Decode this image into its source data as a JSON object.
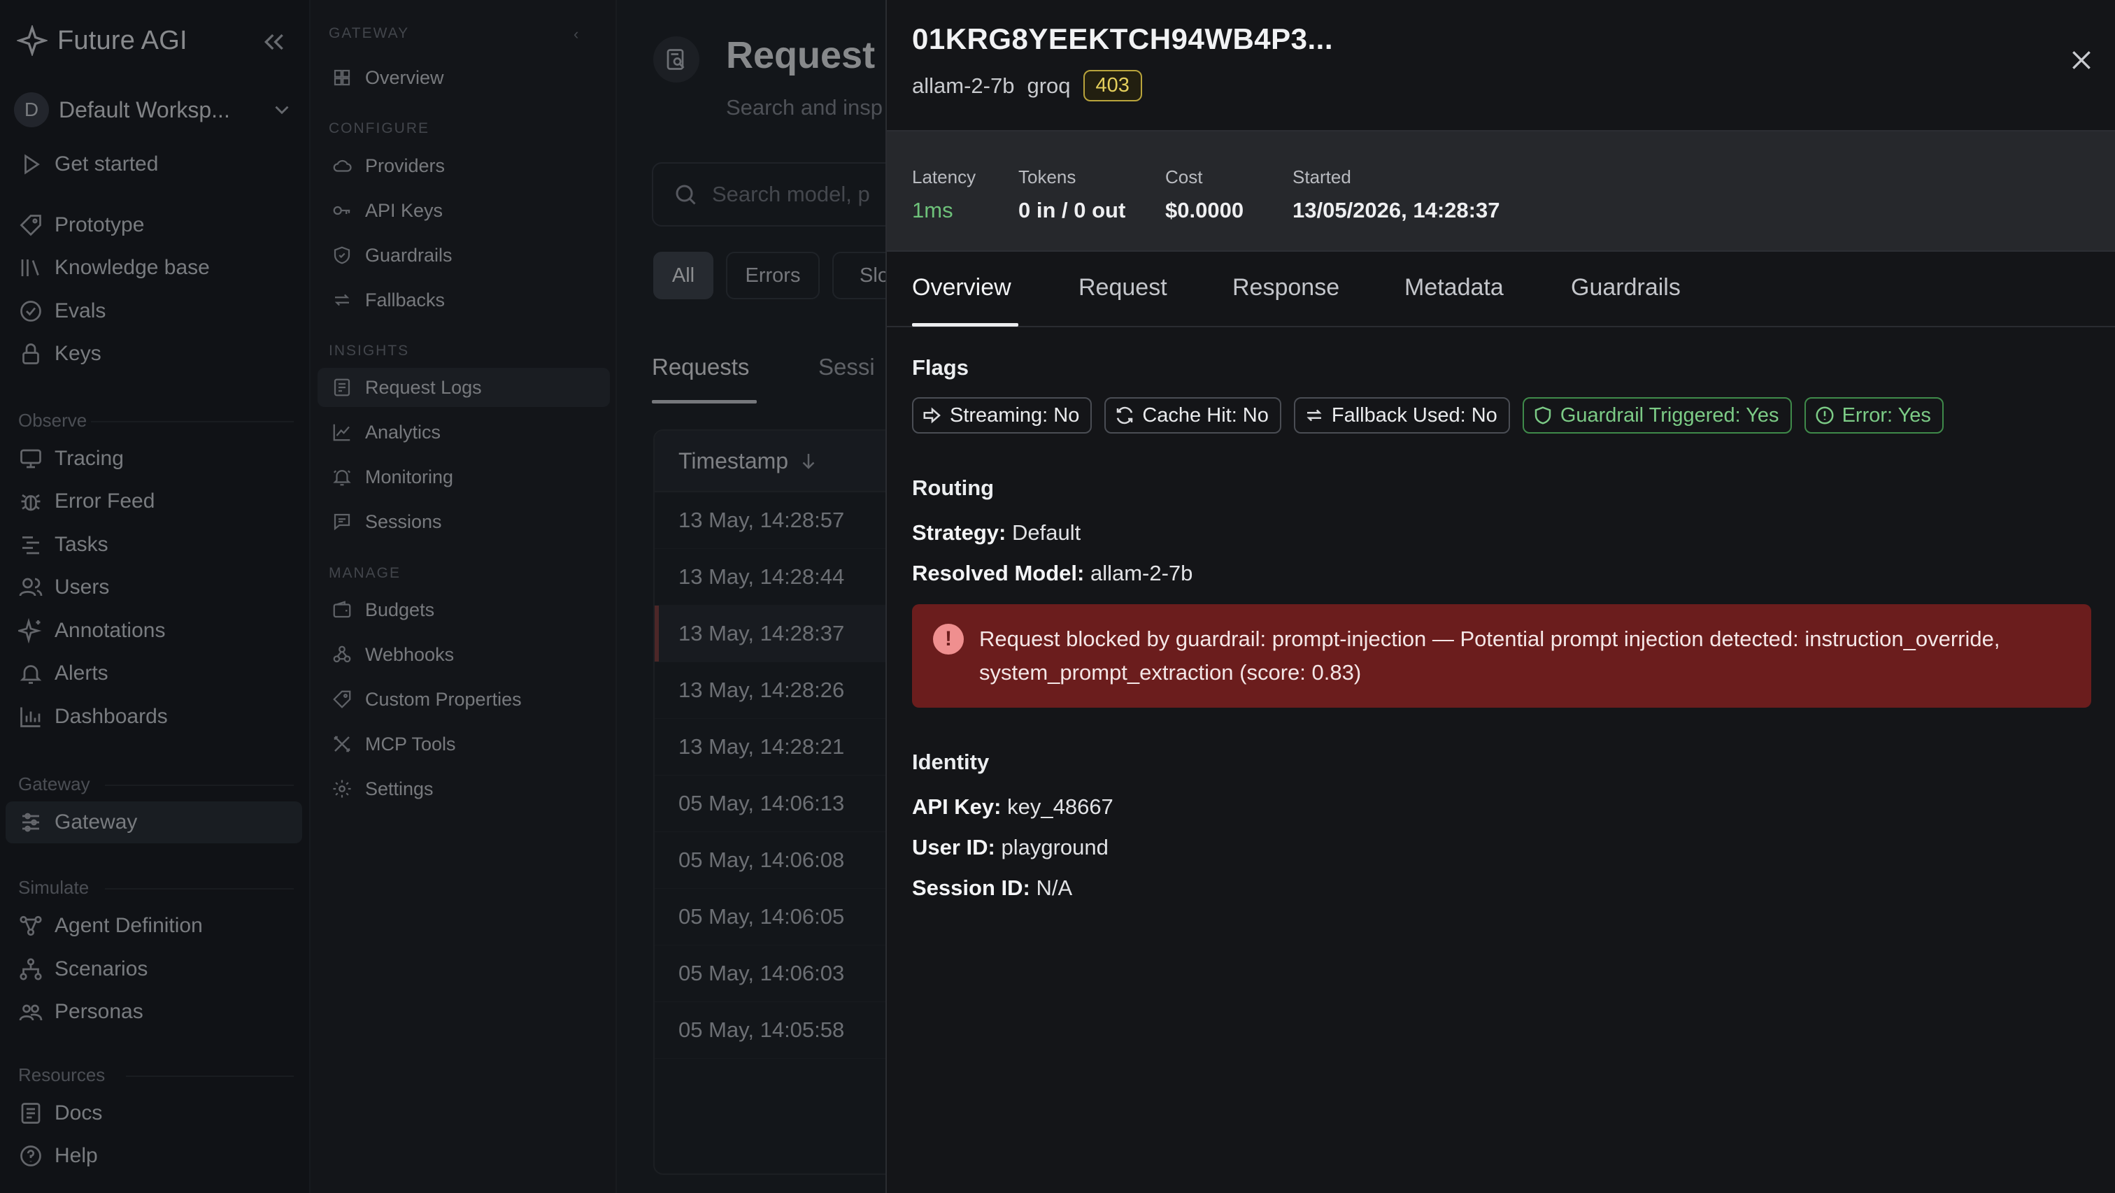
{
  "brand": {
    "name": "Future AGI"
  },
  "workspace": {
    "initial": "D",
    "name": "Default Worksp..."
  },
  "sidebar": {
    "top_items": [
      {
        "label": "Get started",
        "icon": "play-icon"
      },
      {
        "label": "Prototype",
        "icon": "tag-icon"
      },
      {
        "label": "Knowledge base",
        "icon": "library-icon"
      },
      {
        "label": "Evals",
        "icon": "check-circle-icon"
      },
      {
        "label": "Keys",
        "icon": "lock-icon"
      }
    ],
    "observe_label": "Observe",
    "observe_items": [
      {
        "label": "Tracing",
        "icon": "monitor-icon"
      },
      {
        "label": "Error Feed",
        "icon": "bug-icon"
      },
      {
        "label": "Tasks",
        "icon": "tasks-icon"
      },
      {
        "label": "Users",
        "icon": "users-icon"
      },
      {
        "label": "Annotations",
        "icon": "sparkle-icon"
      },
      {
        "label": "Alerts",
        "icon": "bell-icon"
      },
      {
        "label": "Dashboards",
        "icon": "bar-chart-icon"
      }
    ],
    "gateway_label": "Gateway",
    "gateway_items": [
      {
        "label": "Gateway",
        "icon": "sliders-icon"
      }
    ],
    "simulate_label": "Simulate",
    "simulate_items": [
      {
        "label": "Agent Definition",
        "icon": "nodes-icon"
      },
      {
        "label": "Scenarios",
        "icon": "hierarchy-icon"
      },
      {
        "label": "Personas",
        "icon": "people-icon"
      }
    ],
    "resources_label": "Resources",
    "resources_items": [
      {
        "label": "Docs",
        "icon": "book-icon"
      },
      {
        "label": "Help",
        "icon": "help-icon"
      }
    ]
  },
  "subnav": {
    "gateway_label": "GATEWAY",
    "gateway_items": [
      {
        "label": "Overview",
        "icon": "grid-icon"
      }
    ],
    "configure_label": "CONFIGURE",
    "configure_items": [
      {
        "label": "Providers",
        "icon": "cloud-icon"
      },
      {
        "label": "API Keys",
        "icon": "key-icon"
      },
      {
        "label": "Guardrails",
        "icon": "shield-icon"
      },
      {
        "label": "Fallbacks",
        "icon": "swap-icon"
      }
    ],
    "insights_label": "INSIGHTS",
    "insights_items": [
      {
        "label": "Request Logs",
        "icon": "doc-list-icon"
      },
      {
        "label": "Analytics",
        "icon": "line-chart-icon"
      },
      {
        "label": "Monitoring",
        "icon": "bell-ring-icon"
      },
      {
        "label": "Sessions",
        "icon": "message-icon"
      }
    ],
    "manage_label": "MANAGE",
    "manage_items": [
      {
        "label": "Budgets",
        "icon": "wallet-icon"
      },
      {
        "label": "Webhooks",
        "icon": "webhook-icon"
      },
      {
        "label": "Custom Properties",
        "icon": "tag-icon"
      },
      {
        "label": "MCP Tools",
        "icon": "tools-icon"
      },
      {
        "label": "Settings",
        "icon": "gear-icon"
      }
    ]
  },
  "main": {
    "title": "Request",
    "subtitle": "Search and insp",
    "search_placeholder": "Search model, p",
    "filters": [
      "All",
      "Errors",
      "Slo"
    ],
    "tabs": [
      "Requests",
      "Sessi"
    ],
    "table": {
      "header": "Timestamp",
      "rows": [
        "13 May, 14:28:57",
        "13 May, 14:28:44",
        "13 May, 14:28:37",
        "13 May, 14:28:26",
        "13 May, 14:28:21",
        "05 May, 14:06:13",
        "05 May, 14:06:08",
        "05 May, 14:06:05",
        "05 May, 14:06:03",
        "05 May, 14:05:58"
      ]
    }
  },
  "drawer": {
    "title": "01KRG8YEEKTCH94WB4P3...",
    "model": "allam-2-7b",
    "provider": "groq",
    "status_code": "403",
    "stats": [
      {
        "label": "Latency",
        "value": "1ms"
      },
      {
        "label": "Tokens",
        "value": "0 in / 0 out"
      },
      {
        "label": "Cost",
        "value": "$0.0000"
      },
      {
        "label": "Started",
        "value": "13/05/2026, 14:28:37"
      }
    ],
    "tabs": [
      "Overview",
      "Request",
      "Response",
      "Metadata",
      "Guardrails"
    ],
    "flags_title": "Flags",
    "flags": [
      {
        "label": "Streaming: No",
        "icon": "arrow-right-box-icon"
      },
      {
        "label": "Cache Hit: No",
        "icon": "refresh-icon"
      },
      {
        "label": "Fallback Used: No",
        "icon": "swap-icon"
      },
      {
        "label": "Guardrail Triggered: Yes",
        "icon": "shield-icon"
      },
      {
        "label": "Error: Yes",
        "icon": "alert-circle-icon"
      }
    ],
    "routing_title": "Routing",
    "strategy_label": "Strategy:",
    "strategy_value": "Default",
    "resolved_label": "Resolved Model:",
    "resolved_value": "allam-2-7b",
    "alert_text": "Request blocked by guardrail: prompt-injection — Potential prompt injection detected: instruction_override, system_prompt_extraction (score: 0.83)",
    "identity_title": "Identity",
    "api_key_label": "API Key:",
    "api_key_value": "key_48667",
    "user_id_label": "User ID:",
    "user_id_value": "playground",
    "session_id_label": "Session ID:",
    "session_id_value": "N/A"
  },
  "colors": {
    "accent_green": "#6ec27a",
    "alert_bg": "#6b1d1d",
    "badge_yellow": "#e4cf5c"
  }
}
